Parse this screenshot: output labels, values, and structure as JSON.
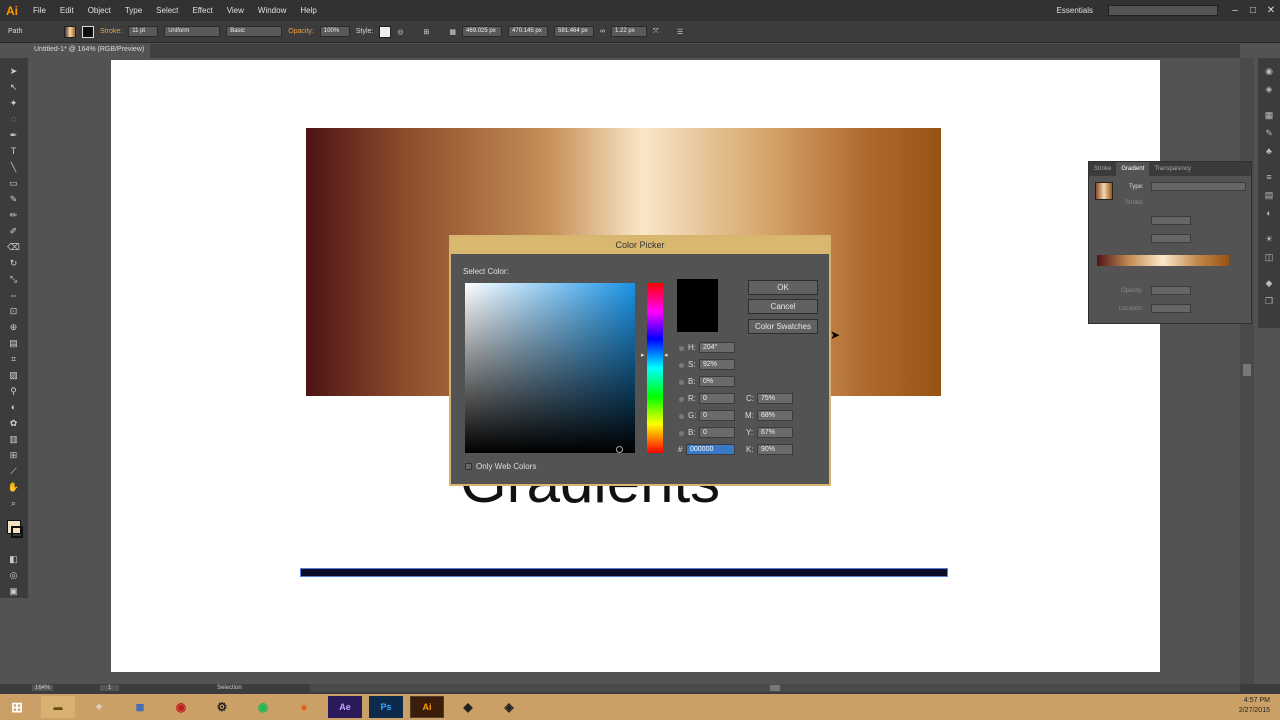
{
  "app": {
    "logo": "Ai"
  },
  "menu": [
    "File",
    "Edit",
    "Object",
    "Type",
    "Select",
    "Effect",
    "View",
    "Window",
    "Help"
  ],
  "workspace": "Essentials",
  "control_bar": {
    "selection_type": "Path",
    "stroke_label": "Stroke:",
    "stroke_value": "11 pt",
    "profile_uniform": "Uniform",
    "brush_basic": "Basic",
    "opacity_label": "Opacity:",
    "opacity_value": "100%",
    "style_label": "Style:",
    "x_value": "469.025 px",
    "y_value": "470.145 px",
    "w_value": "591.464 px",
    "h_value": "1.22 px"
  },
  "document_tab": "Untitled-1* @ 164% (RGB/Preview)",
  "canvas": {
    "text": "Gradients"
  },
  "gradient_panel": {
    "tabs": [
      "Stroke",
      "Gradient",
      "Transparency"
    ],
    "type_label": "Type:",
    "stroke_label": "Stroke:",
    "opacity_label": "Opacity:",
    "location_label": "Location:"
  },
  "color_picker": {
    "title": "Color Picker",
    "select_color": "Select Color:",
    "ok": "OK",
    "cancel": "Cancel",
    "swatches": "Color Swatches",
    "h_label": "H:",
    "h_value": "204°",
    "s_label": "S:",
    "s_value": "92%",
    "b_label": "B:",
    "b_value": "0%",
    "r_label": "R:",
    "r_value": "0",
    "g_label": "G:",
    "g_value": "0",
    "b2_label": "B:",
    "b2_value": "0",
    "hash_label": "#",
    "hex_value": "000000",
    "c_label": "C:",
    "c_value": "75%",
    "m_label": "M:",
    "m_value": "68%",
    "y_label": "Y:",
    "y_value": "67%",
    "k_label": "K:",
    "k_value": "90%",
    "web_only": "Only Web Colors",
    "preview_color": "#000000"
  },
  "status": {
    "zoom": "164%",
    "page": "1",
    "tool": "Selection"
  },
  "taskbar": {
    "apps": [
      "Ae",
      "Ps",
      "Ai"
    ],
    "time": "4:57 PM",
    "date": "2/27/2015"
  }
}
